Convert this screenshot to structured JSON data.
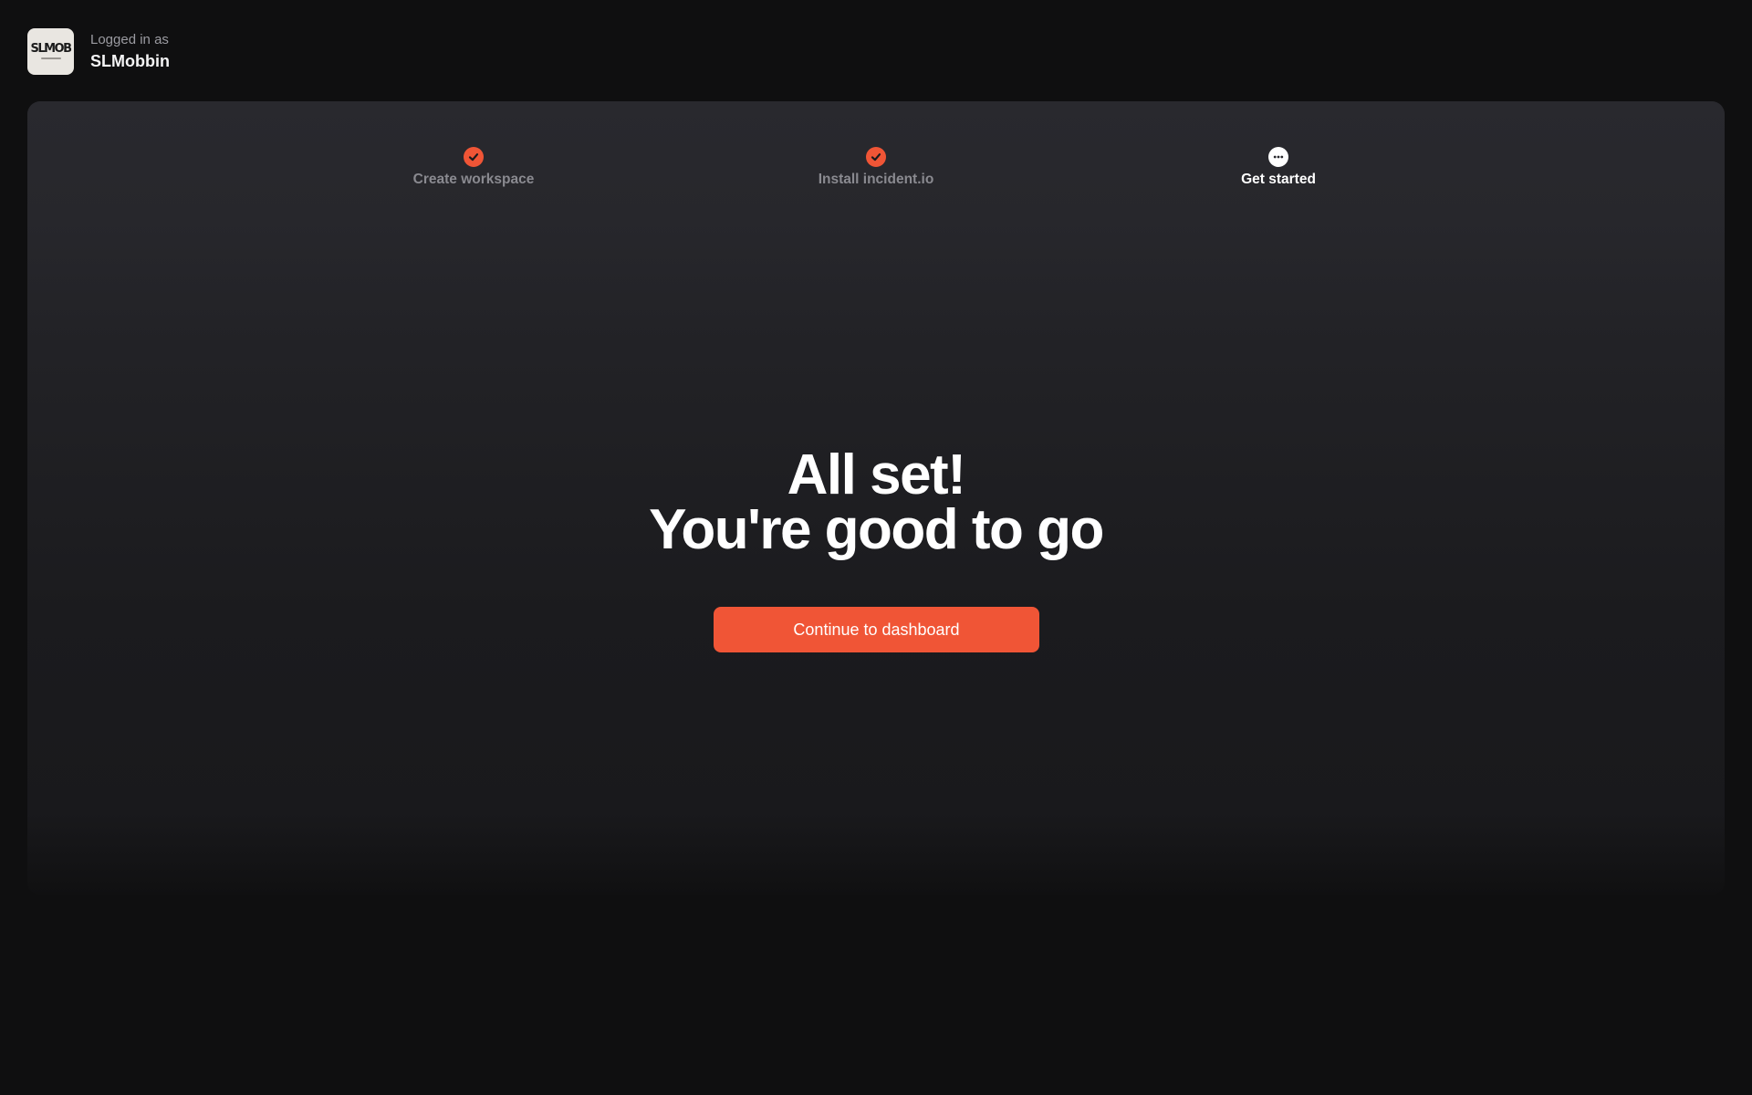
{
  "account": {
    "avatar_text": "SLMOB",
    "caption": "Logged in as",
    "name": "SLMobbin"
  },
  "stepper": {
    "steps": [
      {
        "label": "Create workspace",
        "status": "complete",
        "icon": "check-icon"
      },
      {
        "label": "Install incident.io",
        "status": "complete",
        "icon": "check-icon"
      },
      {
        "label": "Get started",
        "status": "current",
        "icon": "more-dots-icon"
      }
    ]
  },
  "hero": {
    "line1": "All set!",
    "line2": "You're good to go"
  },
  "cta": {
    "label": "Continue to dashboard"
  },
  "colors": {
    "accent": "#f05536",
    "background": "#0f0f10",
    "card": "#29292e"
  }
}
